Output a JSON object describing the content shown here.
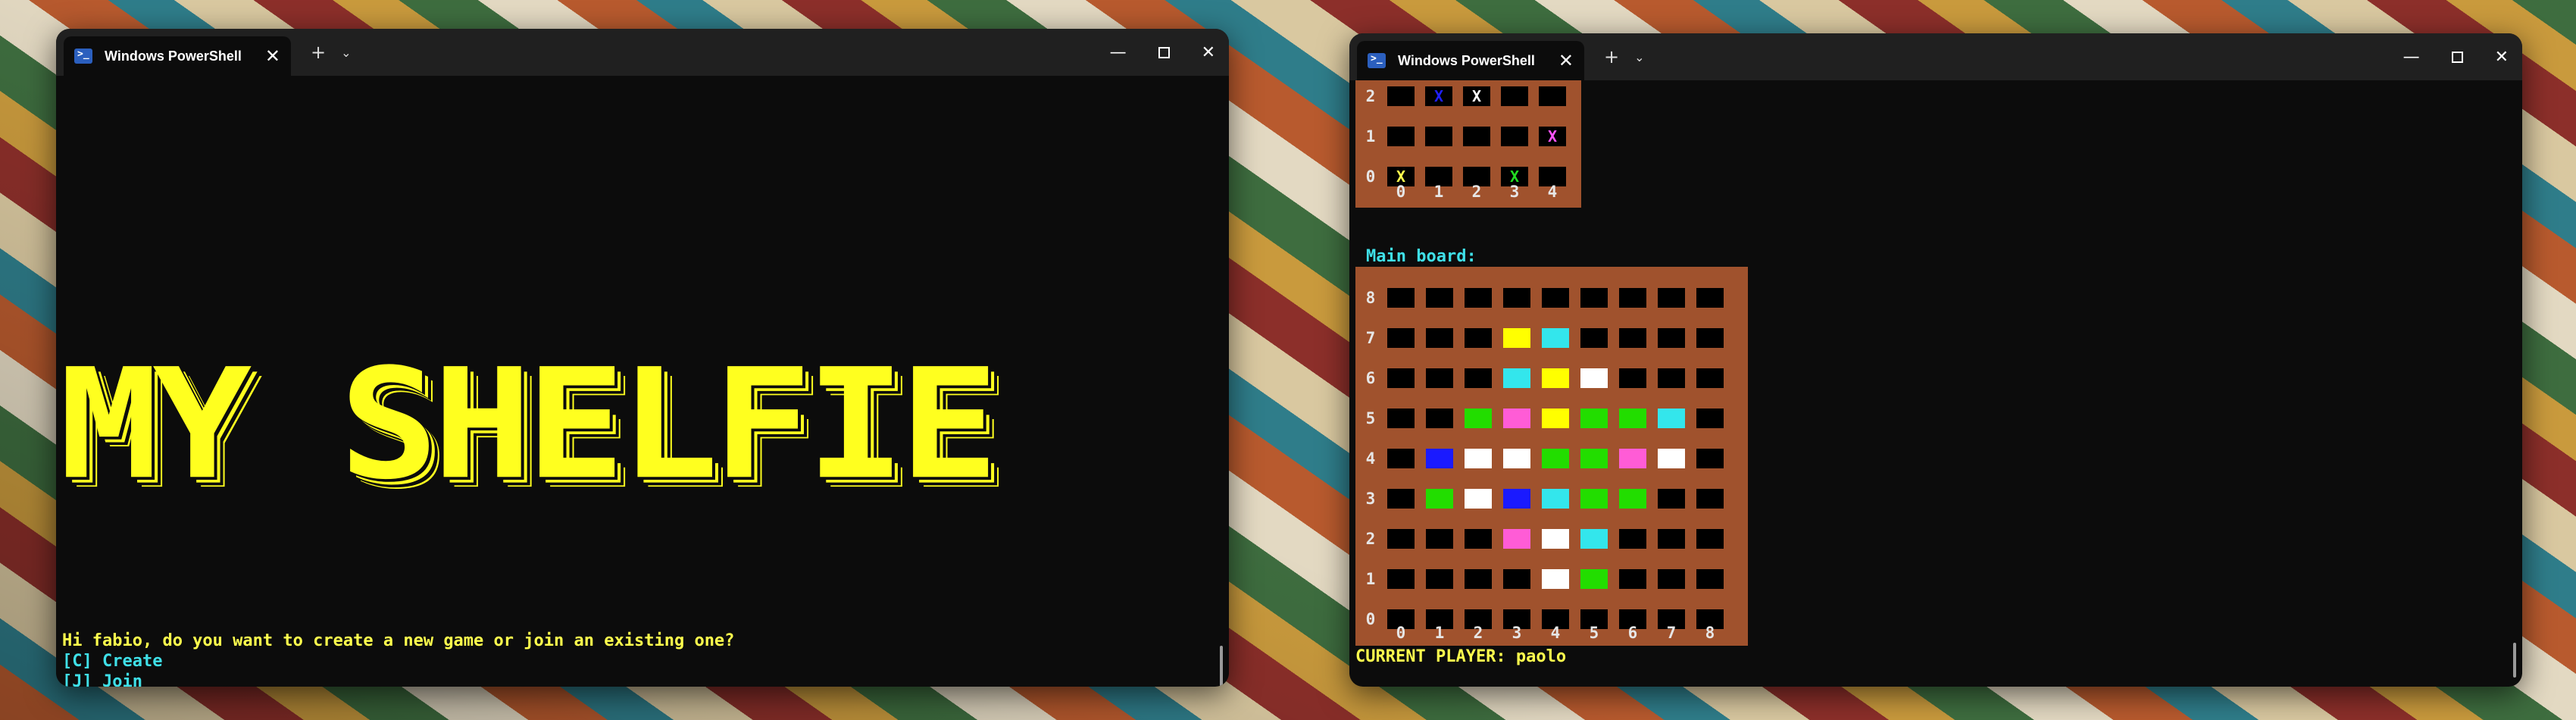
{
  "left_window": {
    "tab_title": "Windows PowerShell",
    "logo_text": "MY SHELFIE",
    "prompt": "Hi fabio, do you want to create a new game or join an existing one?",
    "option_create": "[C] Create",
    "option_join": "[J] Join"
  },
  "right_window": {
    "tab_title": "Windows PowerShell",
    "main_board_label": "Main board:",
    "current_player_label": "CURRENT PLAYER: paolo",
    "shelf": {
      "row_labels": [
        "2",
        "1",
        "0"
      ],
      "col_labels": [
        "0",
        "1",
        "2",
        "3",
        "4"
      ],
      "marks": [
        {
          "row": 0,
          "col": 1,
          "text": "X",
          "color": "#2020ff"
        },
        {
          "row": 0,
          "col": 2,
          "text": "X",
          "color": "#ffffff"
        },
        {
          "row": 1,
          "col": 4,
          "text": "X",
          "color": "#ff55ff"
        },
        {
          "row": 2,
          "col": 0,
          "text": "X",
          "color": "#ffff4d"
        },
        {
          "row": 2,
          "col": 3,
          "text": "X",
          "color": "#22dd22"
        }
      ]
    },
    "main_board": {
      "row_labels": [
        "8",
        "7",
        "6",
        "5",
        "4",
        "3",
        "2",
        "1",
        "0"
      ],
      "col_labels": [
        "0",
        "1",
        "2",
        "3",
        "4",
        "5",
        "6",
        "7",
        "8"
      ],
      "tiles": [
        {
          "row": 1,
          "col": 3,
          "color": "#ffff00"
        },
        {
          "row": 1,
          "col": 4,
          "color": "#33e6ec"
        },
        {
          "row": 2,
          "col": 3,
          "color": "#33e6ec"
        },
        {
          "row": 2,
          "col": 4,
          "color": "#ffff00"
        },
        {
          "row": 2,
          "col": 5,
          "color": "#ffffff"
        },
        {
          "row": 3,
          "col": 2,
          "color": "#22dd00"
        },
        {
          "row": 3,
          "col": 3,
          "color": "#ff5cd6"
        },
        {
          "row": 3,
          "col": 4,
          "color": "#ffff00"
        },
        {
          "row": 3,
          "col": 5,
          "color": "#22dd00"
        },
        {
          "row": 3,
          "col": 6,
          "color": "#22dd00"
        },
        {
          "row": 3,
          "col": 7,
          "color": "#33e6ec"
        },
        {
          "row": 4,
          "col": 1,
          "color": "#1a1aff"
        },
        {
          "row": 4,
          "col": 2,
          "color": "#ffffff"
        },
        {
          "row": 4,
          "col": 3,
          "color": "#ffffff"
        },
        {
          "row": 4,
          "col": 4,
          "color": "#22dd00"
        },
        {
          "row": 4,
          "col": 5,
          "color": "#22dd00"
        },
        {
          "row": 4,
          "col": 6,
          "color": "#ff5cd6"
        },
        {
          "row": 4,
          "col": 7,
          "color": "#ffffff"
        },
        {
          "row": 5,
          "col": 1,
          "color": "#22dd00"
        },
        {
          "row": 5,
          "col": 2,
          "color": "#ffffff"
        },
        {
          "row": 5,
          "col": 3,
          "color": "#1a1aff"
        },
        {
          "row": 5,
          "col": 4,
          "color": "#33e6ec"
        },
        {
          "row": 5,
          "col": 5,
          "color": "#22dd00"
        },
        {
          "row": 5,
          "col": 6,
          "color": "#22dd00"
        },
        {
          "row": 6,
          "col": 3,
          "color": "#ff5cd6"
        },
        {
          "row": 6,
          "col": 4,
          "color": "#ffffff"
        },
        {
          "row": 6,
          "col": 5,
          "color": "#33e6ec"
        },
        {
          "row": 7,
          "col": 4,
          "color": "#ffffff"
        },
        {
          "row": 7,
          "col": 5,
          "color": "#22dd00"
        }
      ]
    }
  },
  "colors": {
    "terminal_bg": "#0c0c0c",
    "titlebar_bg": "#202020",
    "board_brown": "#a0522d",
    "text_yellow": "#ffff4d",
    "text_cyan": "#3fe0e8"
  }
}
